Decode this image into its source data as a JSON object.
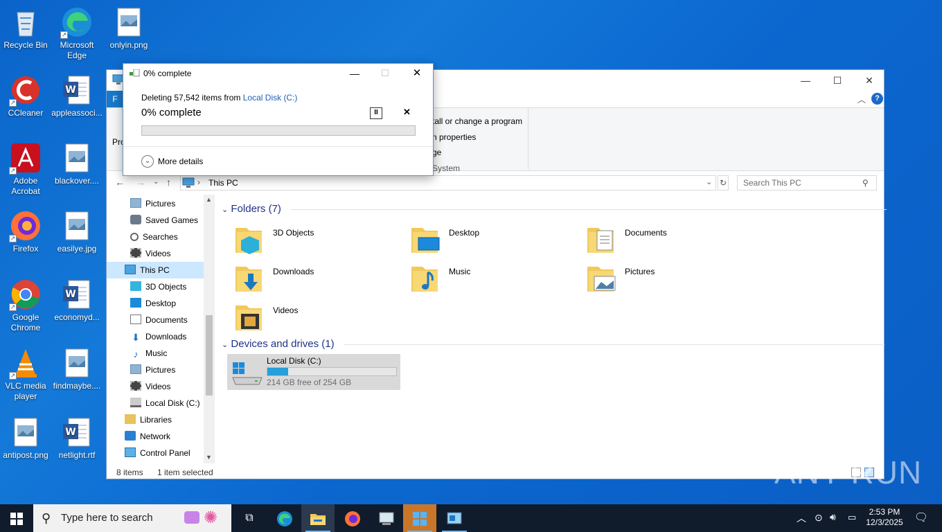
{
  "desktop": {
    "icons": [
      {
        "label": "Recycle Bin",
        "icon": "recycle-bin-icon"
      },
      {
        "label": "Microsoft Edge",
        "icon": "edge-icon"
      },
      {
        "label": "onlyin.png",
        "icon": "image-file-icon"
      },
      {
        "label": "CCleaner",
        "icon": "ccleaner-icon"
      },
      {
        "label": "appleassoci...",
        "icon": "word-doc-icon"
      },
      {
        "label": "Adobe Acrobat",
        "icon": "acrobat-icon"
      },
      {
        "label": "blackover....",
        "icon": "image-file-icon"
      },
      {
        "label": "Firefox",
        "icon": "firefox-icon"
      },
      {
        "label": "easilye.jpg",
        "icon": "image-file-icon"
      },
      {
        "label": "Google Chrome",
        "icon": "chrome-icon"
      },
      {
        "label": "economyd...",
        "icon": "word-doc-icon"
      },
      {
        "label": "VLC media player",
        "icon": "vlc-icon"
      },
      {
        "label": "findmaybe....",
        "icon": "image-file-icon"
      },
      {
        "label": "antipost.png",
        "icon": "image-file-icon"
      },
      {
        "label": "netlight.rtf",
        "icon": "word-doc-icon"
      }
    ]
  },
  "dialog": {
    "title": "0% complete",
    "deleting_prefix": "Deleting 57,542 items from",
    "location": "Local Disk (C:)",
    "percent_label": "0% complete",
    "progress": 0,
    "pause_symbol": "II",
    "cancel_symbol": "✕",
    "more_details": "More details"
  },
  "explorer": {
    "ribbon": {
      "file_tab": "F",
      "properties_fragment": "Pro",
      "system_items": [
        "tall or change a program",
        "n properties",
        "ge",
        "System"
      ]
    },
    "address": {
      "path": "This PC",
      "search_placeholder": "Search This PC"
    },
    "nav": [
      {
        "label": "Pictures",
        "icon": "pictures-icon",
        "indent": 1
      },
      {
        "label": "Saved Games",
        "icon": "saved-games-icon",
        "indent": 1
      },
      {
        "label": "Searches",
        "icon": "searches-icon",
        "indent": 1
      },
      {
        "label": "Videos",
        "icon": "videos-icon",
        "indent": 1
      },
      {
        "label": "This PC",
        "icon": "this-pc-icon",
        "indent": 0,
        "selected": true
      },
      {
        "label": "3D Objects",
        "icon": "3d-objects-icon",
        "indent": 1
      },
      {
        "label": "Desktop",
        "icon": "desktop-icon",
        "indent": 1
      },
      {
        "label": "Documents",
        "icon": "documents-icon",
        "indent": 1
      },
      {
        "label": "Downloads",
        "icon": "downloads-icon",
        "indent": 1
      },
      {
        "label": "Music",
        "icon": "music-icon",
        "indent": 1
      },
      {
        "label": "Pictures",
        "icon": "pictures-icon",
        "indent": 1
      },
      {
        "label": "Videos",
        "icon": "videos-icon",
        "indent": 1
      },
      {
        "label": "Local Disk (C:)",
        "icon": "drive-icon",
        "indent": 1
      },
      {
        "label": "Libraries",
        "icon": "libraries-icon",
        "indent": 0
      },
      {
        "label": "Network",
        "icon": "network-icon",
        "indent": 0
      },
      {
        "label": "Control Panel",
        "icon": "control-panel-icon",
        "indent": 0
      }
    ],
    "folders_header": "Folders (7)",
    "folders": [
      "3D Objects",
      "Desktop",
      "Documents",
      "Downloads",
      "Music",
      "Pictures",
      "Videos"
    ],
    "devices_header": "Devices and drives (1)",
    "drive": {
      "name": "Local Disk (C:)",
      "free_text": "214 GB free of 254 GB",
      "used_fraction": 0.16
    },
    "status": {
      "items": "8 items",
      "selected": "1 item selected"
    }
  },
  "taskbar": {
    "search_placeholder": "Type here to search",
    "time": "2:53 PM",
    "date": "12/3/2025"
  },
  "watermark": "ANY RUN",
  "colors": {
    "accent": "#0078d7",
    "progress": "#06b025",
    "drive_bar": "#26a0da",
    "group_header": "#1e3287"
  }
}
